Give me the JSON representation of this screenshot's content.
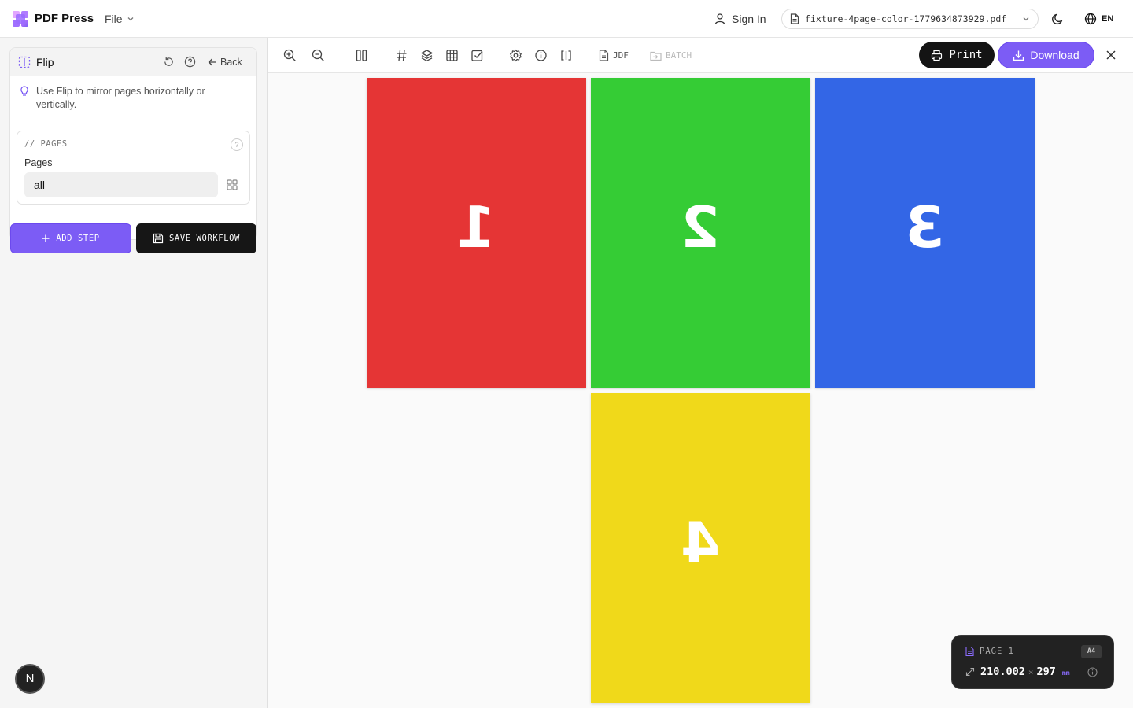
{
  "app": {
    "brand": "PDF Press",
    "file_menu": "File",
    "sign_in": "Sign In",
    "file_name": "fixture-4page-color-1779634873929.pdf",
    "language": "EN"
  },
  "sidebar": {
    "tool_title": "Flip",
    "back_label": "Back",
    "hint": "Use Flip to mirror pages horizontally or vertically.",
    "section_title": "// PAGES",
    "help_mark": "?",
    "pages_label": "Pages",
    "pages_value": "all",
    "add_step": "ADD STEP",
    "save_workflow": "SAVE WORKFLOW",
    "badge_letter": "N"
  },
  "toolbar": {
    "jdf": "JDF",
    "batch": "BATCH",
    "print": "Print",
    "download": "Download"
  },
  "pages": [
    {
      "number": "1",
      "color": "#e53535"
    },
    {
      "number": "2",
      "color": "#35cc35"
    },
    {
      "number": "3",
      "color": "#3366e6"
    },
    {
      "number": "4",
      "color": "#f0d91a"
    }
  ],
  "info_panel": {
    "page_label": "PAGE 1",
    "size_badge": "A4",
    "width": "210.002",
    "times": "×",
    "height": "297",
    "unit": "mm"
  },
  "colors": {
    "accent": "#7c5cf5",
    "dark": "#141414"
  }
}
